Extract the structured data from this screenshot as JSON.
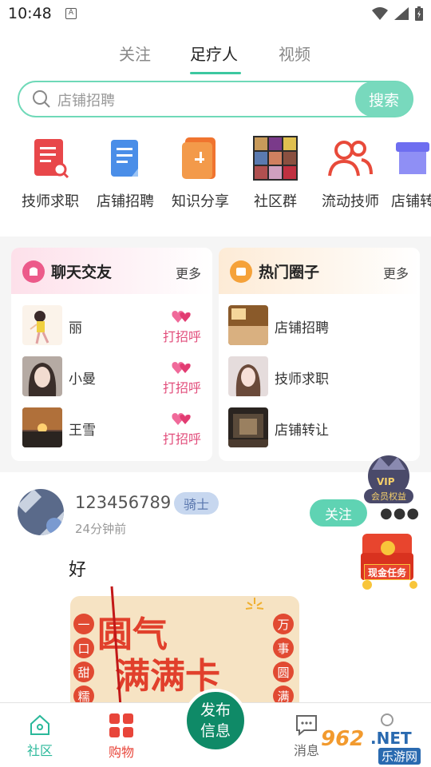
{
  "status": {
    "time": "10:48",
    "notif_letter": "A"
  },
  "tabs": [
    {
      "label": "关注",
      "active": false
    },
    {
      "label": "足疗人",
      "active": true
    },
    {
      "label": "视频",
      "active": false
    }
  ],
  "search": {
    "placeholder": "店铺招聘",
    "button": "搜索"
  },
  "categories": [
    {
      "label": "技师求职",
      "icon": "resume-icon"
    },
    {
      "label": "店铺招聘",
      "icon": "document-icon"
    },
    {
      "label": "知识分享",
      "icon": "book-icon"
    },
    {
      "label": "社区群",
      "icon": "group-photo-icon"
    },
    {
      "label": "流动技师",
      "icon": "people-icon"
    },
    {
      "label": "店铺转",
      "icon": "shop-icon"
    }
  ],
  "chat_card": {
    "title": "聊天交友",
    "more": "更多",
    "rows": [
      {
        "name": "丽",
        "action": "打招呼"
      },
      {
        "name": "小曼",
        "action": "打招呼"
      },
      {
        "name": "王雪",
        "action": "打招呼"
      }
    ]
  },
  "circle_card": {
    "title": "热门圈子",
    "more": "更多",
    "rows": [
      {
        "name": "店铺招聘"
      },
      {
        "name": "技师求职"
      },
      {
        "name": "店铺转让"
      }
    ]
  },
  "post": {
    "username": "123456789",
    "rank": "骑士",
    "time": "24分钟前",
    "follow": "关注",
    "text": "好",
    "image_title_line1": "圆气",
    "image_title_line2": "满满卡",
    "image_left": [
      "一",
      "口",
      "甜",
      "糯"
    ],
    "image_right": [
      "万",
      "事",
      "圆",
      "满"
    ]
  },
  "floating": {
    "vip_label": "会员权益",
    "vip_text": "VIP",
    "cash_label": "现金任务"
  },
  "bottom_nav": {
    "community": "社区",
    "shopping": "购物",
    "publish_line1": "发布",
    "publish_line2": "信息",
    "messages": "消息"
  },
  "watermark": {
    "text1": "962",
    "text2": ".NET",
    "text3": "乐游网"
  },
  "colors": {
    "accent": "#3cc8a0",
    "publish": "#0f8a67",
    "pink": "#e24e7c"
  }
}
